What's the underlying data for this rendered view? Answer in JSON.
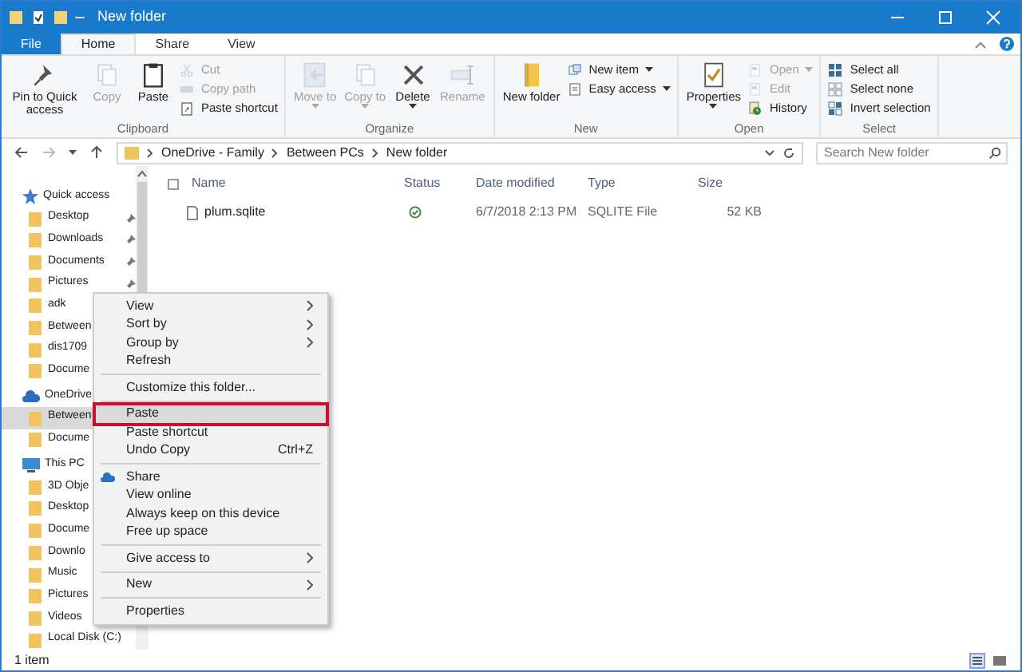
{
  "window": {
    "title": "New folder"
  },
  "tabs": [
    {
      "label": "File",
      "kind": "file",
      "selected": false
    },
    {
      "label": "Home",
      "kind": "tab",
      "selected": true
    },
    {
      "label": "Share",
      "kind": "tab",
      "selected": false
    },
    {
      "label": "View",
      "kind": "tab",
      "selected": false
    }
  ],
  "ribbon": [
    {
      "label": "Clipboard",
      "buttons": [
        {
          "label": "Pin to Quick access",
          "kind": "large",
          "disabled": false,
          "dropdown": false
        },
        {
          "label": "Copy",
          "kind": "large",
          "disabled": true,
          "dropdown": false
        },
        {
          "label": "Paste",
          "kind": "large",
          "disabled": false,
          "dropdown": false
        },
        {
          "label": "Cut",
          "kind": "small",
          "disabled": true,
          "dropdown": false
        },
        {
          "label": "Copy path",
          "kind": "small",
          "disabled": true,
          "dropdown": false
        },
        {
          "label": "Paste shortcut",
          "kind": "small",
          "disabled": false,
          "dropdown": false
        }
      ]
    },
    {
      "label": "Organize",
      "buttons": [
        {
          "label": "Move to",
          "kind": "large",
          "disabled": true,
          "dropdown": true
        },
        {
          "label": "Copy to",
          "kind": "large",
          "disabled": true,
          "dropdown": true
        },
        {
          "label": "Delete",
          "kind": "large",
          "disabled": false,
          "dropdown": true
        },
        {
          "label": "Rename",
          "kind": "large",
          "disabled": true,
          "dropdown": false
        }
      ]
    },
    {
      "label": "New",
      "buttons": [
        {
          "label": "New folder",
          "kind": "large",
          "disabled": false,
          "dropdown": false
        },
        {
          "label": "New item",
          "kind": "small",
          "disabled": false,
          "dropdown": true
        },
        {
          "label": "Easy access",
          "kind": "small",
          "disabled": false,
          "dropdown": true
        }
      ]
    },
    {
      "label": "Open",
      "buttons": [
        {
          "label": "Properties",
          "kind": "large",
          "disabled": false,
          "dropdown": true
        },
        {
          "label": "Open",
          "kind": "small",
          "disabled": true,
          "dropdown": true
        },
        {
          "label": "Edit",
          "kind": "small",
          "disabled": true,
          "dropdown": false
        },
        {
          "label": "History",
          "kind": "small",
          "disabled": false,
          "dropdown": false
        }
      ]
    },
    {
      "label": "Select",
      "buttons": [
        {
          "label": "Select all",
          "kind": "small",
          "disabled": false,
          "dropdown": false
        },
        {
          "label": "Select none",
          "kind": "small",
          "disabled": false,
          "dropdown": false
        },
        {
          "label": "Invert selection",
          "kind": "small",
          "disabled": false,
          "dropdown": false
        }
      ]
    }
  ],
  "address": {
    "path": [
      "OneDrive - Family",
      "Between PCs",
      "New folder"
    ],
    "search_placeholder": "Search New folder"
  },
  "nav": [
    {
      "label": "Quick access",
      "selected": false,
      "children": [
        {
          "label": "Desktop",
          "selected": false,
          "pinned": true
        },
        {
          "label": "Downloads",
          "selected": false,
          "pinned": true
        },
        {
          "label": "Documents",
          "selected": false,
          "pinned": true
        },
        {
          "label": "Pictures",
          "selected": false,
          "pinned": true
        },
        {
          "label": "adk",
          "selected": false
        },
        {
          "label": "Between",
          "selected": false
        },
        {
          "label": "dis1709",
          "selected": false
        },
        {
          "label": "Docume",
          "selected": false
        }
      ]
    },
    {
      "label": "OneDrive",
      "selected": false,
      "children": [
        {
          "label": "Between",
          "selected": true
        },
        {
          "label": "Docume",
          "selected": false
        }
      ]
    },
    {
      "label": "This PC",
      "selected": false,
      "children": [
        {
          "label": "3D Obje",
          "selected": false
        },
        {
          "label": "Desktop",
          "selected": false
        },
        {
          "label": "Docume",
          "selected": false
        },
        {
          "label": "Downlo",
          "selected": false
        },
        {
          "label": "Music",
          "selected": false
        },
        {
          "label": "Pictures",
          "selected": false
        },
        {
          "label": "Videos",
          "selected": false
        },
        {
          "label": "Local Disk (C:)",
          "selected": false
        }
      ]
    }
  ],
  "table": {
    "columns": [
      "Name",
      "Status",
      "Date modified",
      "Type",
      "Size"
    ],
    "all_checked": false,
    "rows": [
      {
        "name": "plum.sqlite",
        "date": "6/7/2018 2:13 PM",
        "type": "SQLITE File",
        "size": "52 KB"
      }
    ]
  },
  "context_menu": [
    {
      "kind": "item",
      "label": "View",
      "submenu": true,
      "highlighted": false
    },
    {
      "kind": "item",
      "label": "Sort by",
      "submenu": true,
      "highlighted": false
    },
    {
      "kind": "item",
      "label": "Group by",
      "submenu": true,
      "highlighted": false
    },
    {
      "kind": "item",
      "label": "Refresh",
      "submenu": false,
      "highlighted": false
    },
    {
      "kind": "separator"
    },
    {
      "kind": "item",
      "label": "Customize this folder...",
      "submenu": false,
      "highlighted": false
    },
    {
      "kind": "separator"
    },
    {
      "kind": "item",
      "label": "Paste",
      "submenu": false,
      "highlighted": true
    },
    {
      "kind": "item",
      "label": "Paste shortcut",
      "submenu": false,
      "highlighted": false
    },
    {
      "kind": "item",
      "label": "Undo Copy",
      "shortcut": "Ctrl+Z",
      "submenu": false,
      "highlighted": false
    },
    {
      "kind": "separator"
    },
    {
      "kind": "share",
      "label": "Share",
      "submenu": false,
      "highlighted": false
    },
    {
      "kind": "item",
      "label": "View online",
      "submenu": false,
      "highlighted": false
    },
    {
      "kind": "item",
      "label": "Always keep on this device",
      "submenu": false,
      "highlighted": false
    },
    {
      "kind": "item",
      "label": "Free up space",
      "submenu": false,
      "highlighted": false
    },
    {
      "kind": "separator"
    },
    {
      "kind": "item",
      "label": "Give access to",
      "submenu": true,
      "highlighted": false
    },
    {
      "kind": "separator"
    },
    {
      "kind": "item",
      "label": "New",
      "submenu": true,
      "highlighted": false
    },
    {
      "kind": "separator"
    },
    {
      "kind": "item",
      "label": "Properties",
      "submenu": false,
      "highlighted": false
    }
  ],
  "status_bar": {
    "text": "1 item"
  }
}
